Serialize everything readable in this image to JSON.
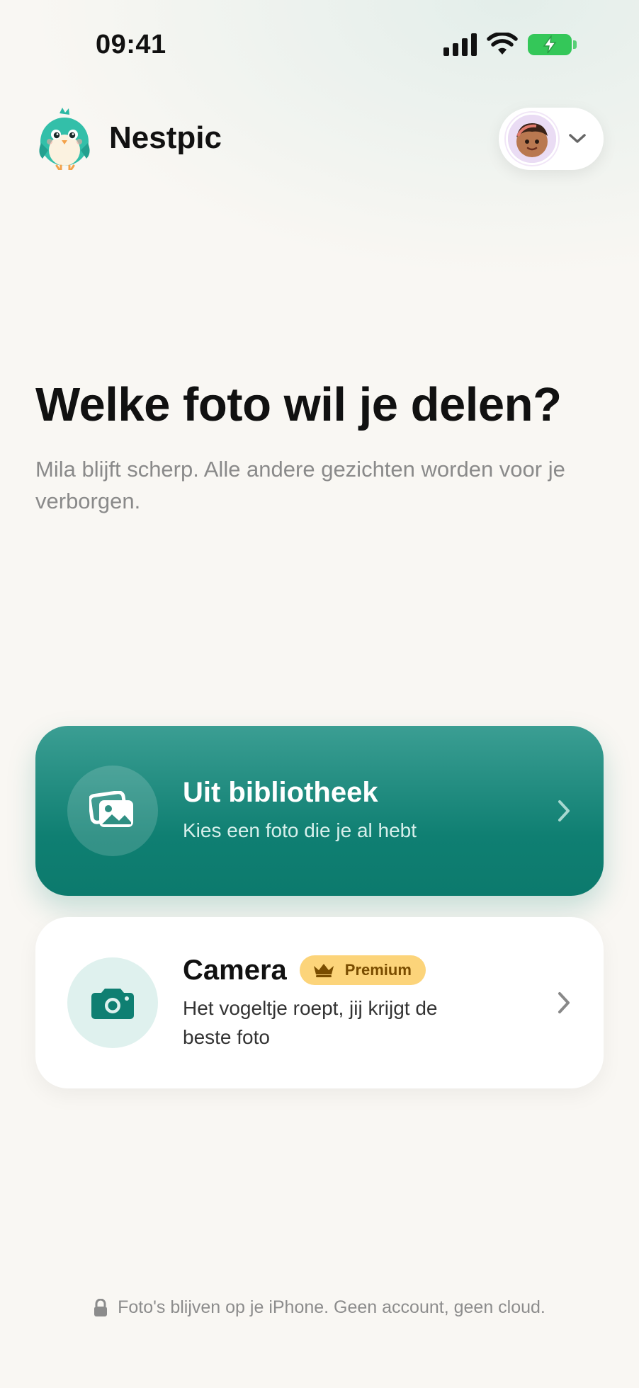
{
  "status_bar": {
    "time": "09:41"
  },
  "header": {
    "app_name": "Nestpic",
    "logo_icon": "bird-mascot-icon",
    "profile_icon": "child-avatar"
  },
  "hero": {
    "title": "Welke foto wil je delen?",
    "subtitle": "Mila blijft scherp. Alle andere gezichten worden voor je verborgen."
  },
  "options": {
    "library": {
      "title": "Uit bibliotheek",
      "subtitle": "Kies een foto die je al hebt",
      "icon": "photo-library-icon"
    },
    "camera": {
      "title": "Camera",
      "badge": "Premium",
      "subtitle": "Het vogeltje roept, jij krijgt de beste foto",
      "icon": "camera-icon"
    }
  },
  "footer": {
    "text": "Foto's blijven op je iPhone. Geen account, geen cloud.",
    "icon": "lock-icon"
  },
  "colors": {
    "primary": "#0f7f72",
    "badge": "#fcd47a",
    "battery": "#34c759"
  }
}
